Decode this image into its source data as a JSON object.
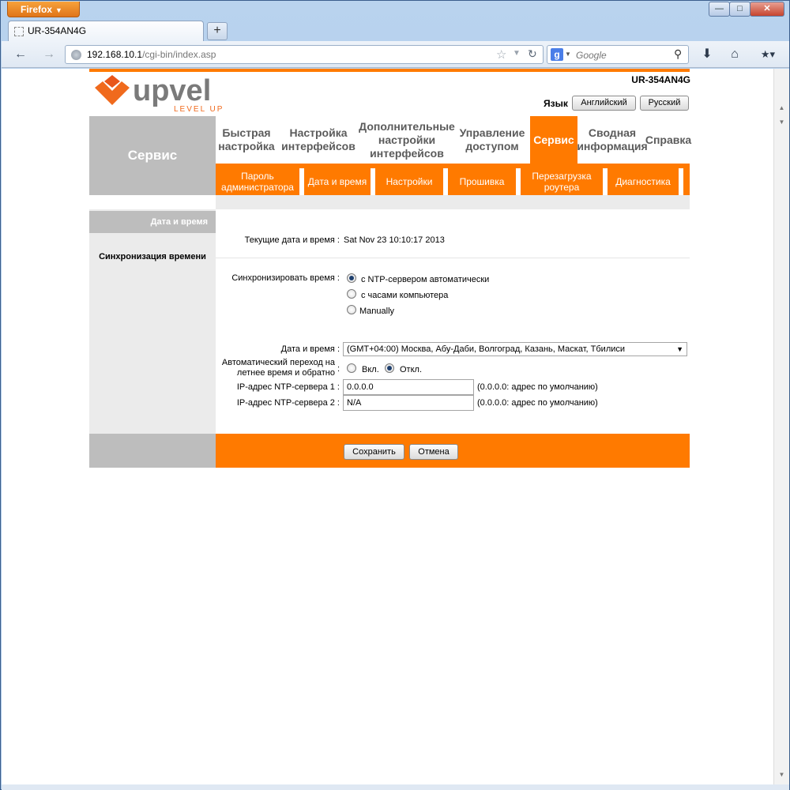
{
  "browser": {
    "menu_label": "Firefox",
    "tab_title": "UR-354AN4G",
    "url_host": "192.168.10.1",
    "url_path": "/cgi-bin/index.asp",
    "search_placeholder": "Google"
  },
  "header": {
    "model": "UR-354AN4G",
    "lang_label": "Язык",
    "lang_en": "Английский",
    "lang_ru": "Русский",
    "logo_text": "upvel",
    "logo_tagline": "LEVEL UP"
  },
  "section_title": "Сервис",
  "main_menu": [
    {
      "label": "Быстрая настройка"
    },
    {
      "label": "Настройка интерфейсов"
    },
    {
      "label": "Дополнительные настройки интерфейсов"
    },
    {
      "label": "Управление доступом"
    },
    {
      "label": "Сервис"
    },
    {
      "label": "Сводная информация"
    },
    {
      "label": "Справка"
    }
  ],
  "sub_menu": [
    {
      "label": "Пароль администратора"
    },
    {
      "label": "Дата и время"
    },
    {
      "label": "Настройки"
    },
    {
      "label": "Прошивка"
    },
    {
      "label": "Перезагрузка роутера"
    },
    {
      "label": "Диагностика"
    }
  ],
  "side": {
    "section": "Дата и время",
    "item": "Синхронизация времени"
  },
  "form": {
    "current_label": "Текущие дата и время :",
    "current_value": "Sat Nov 23 10:10:17 2013",
    "sync_label": "Синхронизировать время :",
    "sync_options": [
      {
        "label": "с NTP-сервером автоматически",
        "selected": true
      },
      {
        "label": "с часами компьютера",
        "selected": false
      },
      {
        "label": "Manually",
        "selected": false
      }
    ],
    "tz_label": "Дата и время :",
    "tz_value": "(GMT+04:00) Москва, Абу-Даби, Волгоград, Казань, Маскат, Тбилиси",
    "dst_label_1": "Автоматический переход на",
    "dst_label_2": "летнее время и обратно",
    "dst_colon": ":",
    "dst_on": "Вкл.",
    "dst_off": "Откл.",
    "dst_selected": "off",
    "ntp1_label": "IP-адрес NTP-сервера 1 :",
    "ntp1_value": "0.0.0.0",
    "ntp1_hint": "(0.0.0.0: адрес по умолчанию)",
    "ntp2_label": "IP-адрес NTP-сервера 2 :",
    "ntp2_value": "N/A",
    "ntp2_hint": "(0.0.0.0: адрес по умолчанию)"
  },
  "buttons": {
    "save": "Сохранить",
    "cancel": "Отмена"
  },
  "colors": {
    "accent": "#ff7a00",
    "side_gray": "#bdbdbd"
  }
}
